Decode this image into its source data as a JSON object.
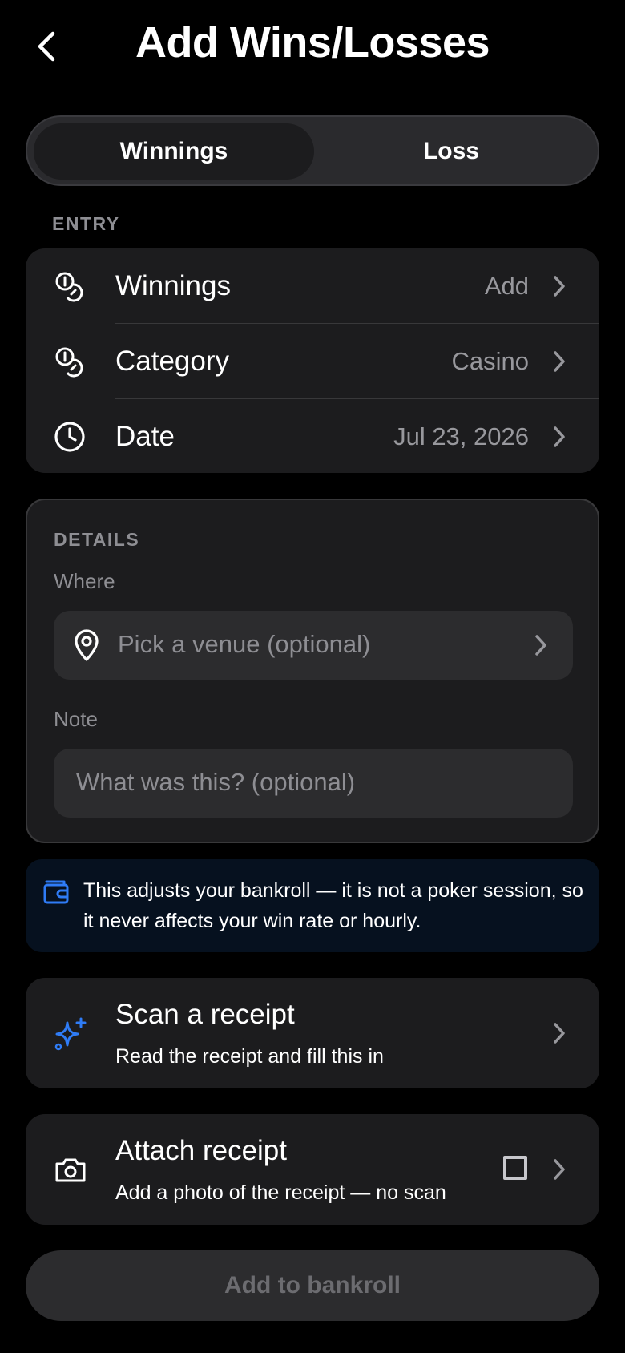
{
  "header": {
    "title": "Add Wins/Losses"
  },
  "segments": {
    "winnings": "Winnings",
    "loss": "Loss",
    "selected": "Winnings"
  },
  "entry": {
    "section_title": "ENTRY",
    "rows": [
      {
        "label": "Winnings",
        "value": "Add",
        "icon": "coins-icon"
      },
      {
        "label": "Category",
        "value": "Casino",
        "icon": "coins-icon"
      },
      {
        "label": "Date",
        "value": "Jul 23, 2026",
        "icon": "clock-icon"
      }
    ]
  },
  "details": {
    "section_title": "DETAILS",
    "where_label": "Where",
    "venue_placeholder": "Pick a venue (optional)",
    "note_label": "Note",
    "note_placeholder": "What was this? (optional)"
  },
  "banner": {
    "text": "This adjusts your bankroll — it is not a poker session, so it never affects your win rate or hourly.",
    "icon": "wallet-icon"
  },
  "scan": {
    "title": "Scan a receipt",
    "subtitle": "Read the receipt and fill this in",
    "icon": "sparkles-icon"
  },
  "attach": {
    "title": "Attach receipt",
    "subtitle": "Add a photo of the receipt — no scan",
    "icon": "camera-icon",
    "checked": false
  },
  "submit": {
    "label": "Add to bankroll"
  },
  "colors": {
    "background": "#000000",
    "card": "#1c1c1e",
    "accent": "#2f7cf6",
    "muted": "#8e8e93",
    "banner": "#06111f"
  }
}
